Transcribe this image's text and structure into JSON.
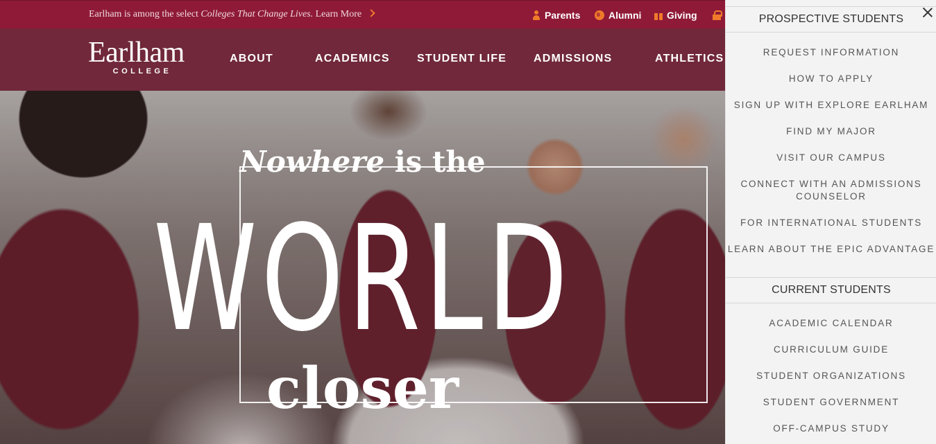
{
  "topbar": {
    "promo_prefix": "Earlham is among the select ",
    "promo_emphasis": "Colleges That Change Lives.",
    "promo_link": " Learn More",
    "utility_links": [
      {
        "label": "Parents",
        "icon": "person-icon"
      },
      {
        "label": "Alumni",
        "icon": "globe-icon"
      },
      {
        "label": "Giving",
        "icon": "gift-icon"
      },
      {
        "label": "",
        "icon": "lock-icon"
      }
    ],
    "accent_color": "#f07a2a",
    "background": "#8f1a37"
  },
  "header": {
    "logo_word": "Earlham",
    "logo_sub": "COLLEGE",
    "nav": [
      "ABOUT",
      "ACADEMICS",
      "STUDENT LIFE",
      "ADMISSIONS",
      "ATHLETICS"
    ],
    "background": "#70283a"
  },
  "hero": {
    "line1_italic": "Nowhere",
    "line1_rest": " is the",
    "line2": "WORLD",
    "line3": "closer"
  },
  "panel": {
    "sections": [
      {
        "title": "PROSPECTIVE STUDENTS",
        "links": [
          "REQUEST INFORMATION",
          "HOW TO APPLY",
          "SIGN UP WITH EXPLORE EARLHAM",
          "FIND MY MAJOR",
          "VISIT OUR CAMPUS",
          "CONNECT WITH AN ADMISSIONS COUNSELOR",
          "FOR INTERNATIONAL STUDENTS",
          "LEARN ABOUT THE EPIC ADVANTAGE"
        ]
      },
      {
        "title": "CURRENT STUDENTS",
        "links": [
          "ACADEMIC CALENDAR",
          "CURRICULUM GUIDE",
          "STUDENT ORGANIZATIONS",
          "STUDENT GOVERNMENT",
          "OFF-CAMPUS STUDY"
        ]
      }
    ]
  }
}
